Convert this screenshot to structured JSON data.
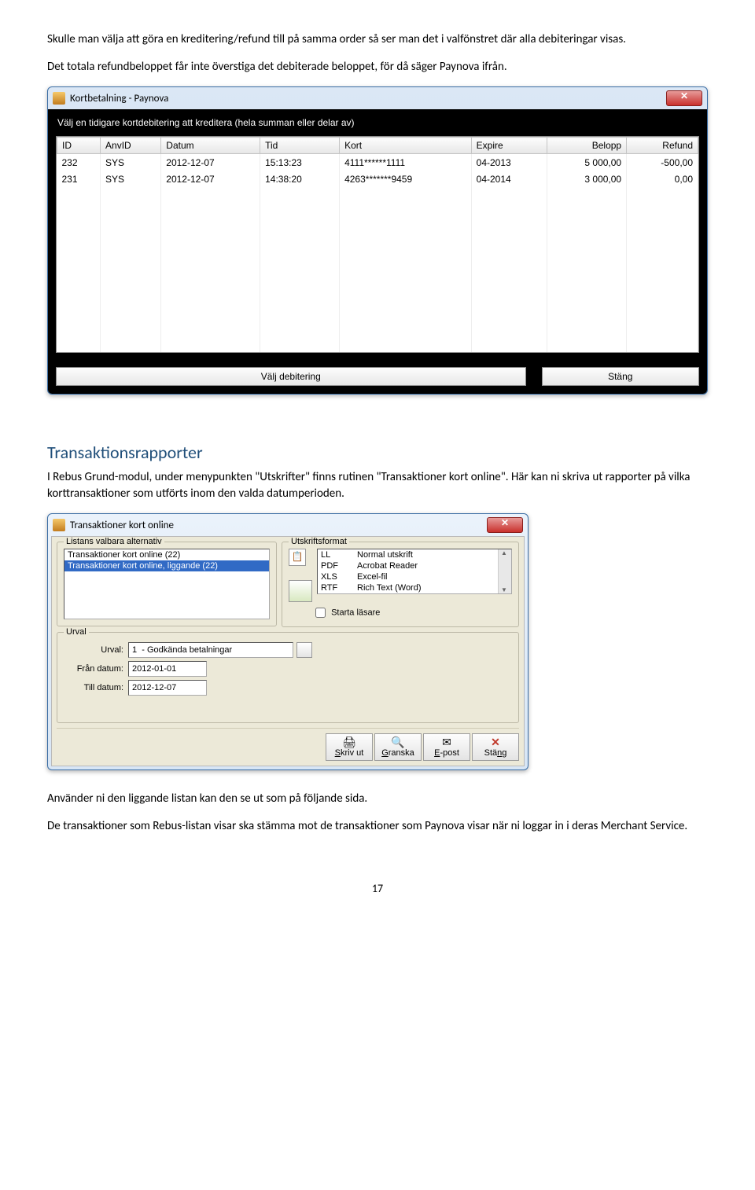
{
  "intro": {
    "p1": "Skulle man välja att göra en kreditering/refund till på samma order så ser man det i valfönstret där alla debiteringar visas.",
    "p2": "Det totala refundbeloppet får inte överstiga det debiterade beloppet, för då säger Paynova ifrån."
  },
  "dialog1": {
    "title": "Kortbetalning - Paynova",
    "instruction": "Välj en tidigare kortdebitering att kreditera (hela summan eller delar av)",
    "columns": [
      "ID",
      "AnvID",
      "Datum",
      "Tid",
      "Kort",
      "Expire",
      "Belopp",
      "Refund"
    ],
    "rows": [
      {
        "id": "232",
        "anv": "SYS",
        "datum": "2012-12-07",
        "tid": "15:13:23",
        "kort": "4111******1111",
        "expire": "04-2013",
        "belopp": "5 000,00",
        "refund": "-500,00"
      },
      {
        "id": "231",
        "anv": "SYS",
        "datum": "2012-12-07",
        "tid": "14:38:20",
        "kort": "4263*******9459",
        "expire": "04-2014",
        "belopp": "3 000,00",
        "refund": "0,00"
      }
    ],
    "btn_choose": "Välj debitering",
    "btn_close": "Stäng"
  },
  "section": {
    "heading": "Transaktionsrapporter",
    "text": "I Rebus Grund-modul, under menypunkten \"Utskrifter\" finns rutinen \"Transaktioner kort online\". Här kan ni skriva ut rapporter på vilka korttransaktioner som utförts inom den valda datumperioden."
  },
  "dialog2": {
    "title": "Transaktioner kort online",
    "grp_list": "Listans valbara alternativ",
    "list_items": [
      "Transaktioner kort online (22)",
      "Transaktioner kort online, liggande (22)"
    ],
    "grp_fmt": "Utskriftsformat",
    "formats": [
      {
        "code": "LL",
        "label": "Normal utskrift"
      },
      {
        "code": "PDF",
        "label": "Acrobat Reader"
      },
      {
        "code": "XLS",
        "label": "Excel-fil"
      },
      {
        "code": "RTF",
        "label": "Rich Text (Word)"
      }
    ],
    "chk_reader": "Starta läsare",
    "grp_urval": "Urval",
    "lbl_urval": "Urval:",
    "val_urval": "1  - Godkända betalningar",
    "lbl_from": "Från datum:",
    "val_from": "2012-01-01",
    "lbl_to": "Till datum:",
    "val_to": "2012-12-07",
    "btn_print": "Skriv ut",
    "btn_preview": "Granska",
    "btn_email": "E-post",
    "btn_close": "Stäng"
  },
  "outro": {
    "p1": "Använder ni den liggande listan kan den se ut som på följande sida.",
    "p2": "De transaktioner som Rebus-listan visar ska stämma mot de transaktioner som Paynova visar när ni loggar in i deras Merchant Service."
  },
  "pagenum": "17"
}
